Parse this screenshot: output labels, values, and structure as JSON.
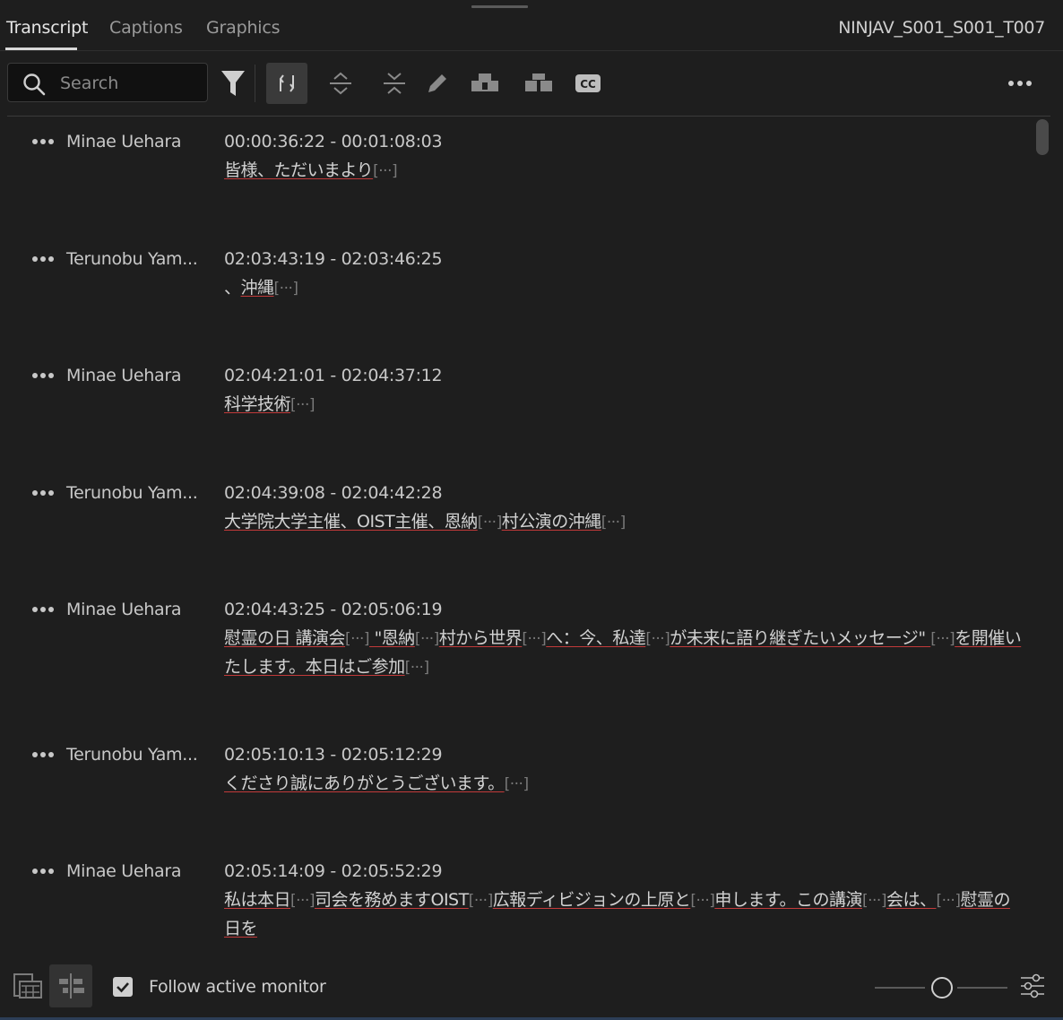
{
  "tabs": [
    {
      "label": "Transcript",
      "active": true
    },
    {
      "label": "Captions",
      "active": false
    },
    {
      "label": "Graphics",
      "active": false
    }
  ],
  "clip_name": "NINJAV_S001_S001_T007",
  "search": {
    "placeholder": "Search",
    "value": ""
  },
  "toolbar_icons": [
    "filter-icon",
    "sync-icon",
    "expand-icon",
    "collapse-icon",
    "pencil-icon",
    "merge-icon",
    "split-icon",
    "cc-icon",
    "more-options-icon"
  ],
  "entries": [
    {
      "speaker": "Minae Uehara",
      "time": "00:00:36:22 - 00:01:08:03",
      "text": [
        {
          "t": "皆様、ただいまより",
          "gap": false
        },
        {
          "t": "[···]",
          "gap": true
        }
      ]
    },
    {
      "speaker": "Terunobu Yam...",
      "time": "02:03:43:19 - 02:03:46:25",
      "text": [
        {
          "t": "、",
          "gap": false,
          "plain": true
        },
        {
          "t": "沖縄",
          "gap": false
        },
        {
          "t": "[···]",
          "gap": true
        }
      ]
    },
    {
      "speaker": "Minae Uehara",
      "time": "02:04:21:01 - 02:04:37:12",
      "text": [
        {
          "t": "科学技術",
          "gap": false
        },
        {
          "t": "[···]",
          "gap": true
        }
      ]
    },
    {
      "speaker": "Terunobu Yam...",
      "time": "02:04:39:08 - 02:04:42:28",
      "text": [
        {
          "t": "大学院大学主催、OIST主催、恩納",
          "gap": false
        },
        {
          "t": "[···]",
          "gap": true
        },
        {
          "t": "村公演の沖縄",
          "gap": false
        },
        {
          "t": "[···]",
          "gap": true
        }
      ]
    },
    {
      "speaker": "Minae Uehara",
      "time": "02:04:43:25 - 02:05:06:19",
      "text": [
        {
          "t": "慰霊の日 講演会",
          "gap": false
        },
        {
          "t": "[···]",
          "gap": true
        },
        {
          "t": " \"恩納",
          "gap": false
        },
        {
          "t": "[···]",
          "gap": true
        },
        {
          "t": "村から世界",
          "gap": false
        },
        {
          "t": "[···]",
          "gap": true
        },
        {
          "t": "へ：今、私達",
          "gap": false
        },
        {
          "t": "[···]",
          "gap": true
        },
        {
          "t": "が未来に語り継ぎたいメッセージ\" ",
          "gap": false
        },
        {
          "t": "[···]",
          "gap": true
        },
        {
          "t": "を開催いたします。本日はご参加",
          "gap": false
        },
        {
          "t": "[···]",
          "gap": true
        }
      ]
    },
    {
      "speaker": "Terunobu Yam...",
      "time": "02:05:10:13 - 02:05:12:29",
      "text": [
        {
          "t": "くださり誠にありがとうございます。",
          "gap": false
        },
        {
          "t": "[···]",
          "gap": true
        }
      ]
    },
    {
      "speaker": "Minae Uehara",
      "time": "02:05:14:09 - 02:05:52:29",
      "text": [
        {
          "t": "私は本日",
          "gap": false
        },
        {
          "t": "[···]",
          "gap": true
        },
        {
          "t": "司会を務めますOIST",
          "gap": false
        },
        {
          "t": "[···]",
          "gap": true
        },
        {
          "t": "広報ディビジョンの上原と",
          "gap": false
        },
        {
          "t": "[···]",
          "gap": true
        },
        {
          "t": "申します。この講演",
          "gap": false
        },
        {
          "t": "[···]",
          "gap": true
        },
        {
          "t": "会は、",
          "gap": false
        },
        {
          "t": "[···]",
          "gap": true
        },
        {
          "t": "慰霊の日を",
          "gap": false
        }
      ]
    }
  ],
  "bottom": {
    "follow_label": "Follow active monitor",
    "follow_checked": true,
    "zoom": 0.5
  },
  "colors": {
    "background": "#1e1e1e",
    "underline": "#c23a3a",
    "text": "#d2d2d2"
  }
}
